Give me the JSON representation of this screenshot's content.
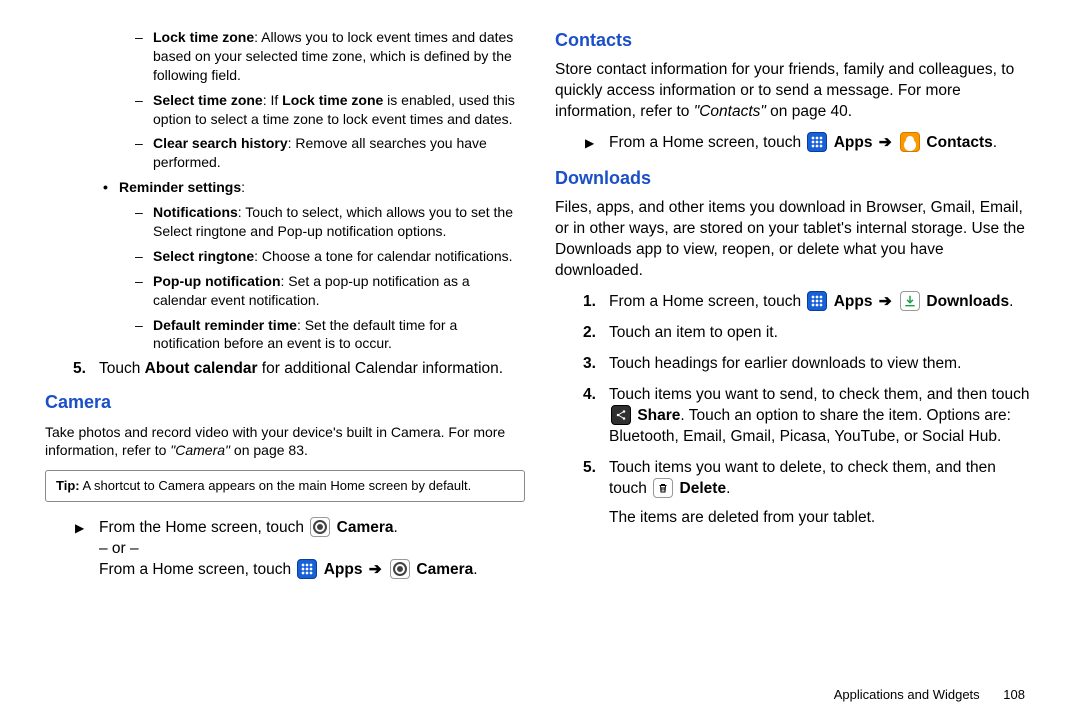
{
  "left": {
    "settings_list": [
      {
        "term": "Lock time zone",
        "desc": ": Allows you to lock event times and dates based on your selected time zone, which is defined by the following field."
      },
      {
        "term": "Select time zone",
        "desc": ": If ",
        "term2": "Lock time zone",
        "desc2": " is enabled, used this option to select a time zone to lock event times and dates."
      },
      {
        "term": "Clear search history",
        "desc": ": Remove all searches you have performed."
      }
    ],
    "reminder_heading": "Reminder settings",
    "reminder_list": [
      {
        "term": "Notifications",
        "desc": ": Touch to select, which allows you to set the Select ringtone and Pop-up notification options."
      },
      {
        "term": "Select ringtone",
        "desc": ": Choose a tone for calendar notifications."
      },
      {
        "term": "Pop-up notification",
        "desc": ": Set a pop-up notification as a calendar event notification."
      },
      {
        "term": "Default reminder time",
        "desc": ": Set the default time for a notification before an event is to occur."
      }
    ],
    "step5": {
      "num": "5.",
      "pre": "Touch ",
      "bold": "About calendar",
      "post": " for additional Calendar information."
    },
    "camera_heading": "Camera",
    "camera_para_a": "Take photos and record video with your device's built in Camera. For more information, refer to ",
    "camera_ref": "\"Camera\"",
    "camera_para_b": " on page 83.",
    "tip_label": "Tip:",
    "tip_text": " A shortcut to Camera appears on the main Home screen by default.",
    "camera_step": {
      "pre": "From the Home screen, touch ",
      "label": "Camera",
      "or": "– or –",
      "pre2": "From a Home screen, touch ",
      "apps": "Apps",
      "arrow": "➔",
      "label2": "Camera"
    }
  },
  "right": {
    "contacts_heading": "Contacts",
    "contacts_para_a": "Store contact information for your friends, family and colleagues, to quickly access information or to send a message. For more information, refer to ",
    "contacts_ref": "\"Contacts\"",
    "contacts_para_b": " on page 40.",
    "contacts_step": {
      "pre": "From a Home screen, touch ",
      "apps": "Apps",
      "arrow": "➔",
      "label": "Contacts"
    },
    "downloads_heading": "Downloads",
    "downloads_para": "Files, apps, and other items you download in Browser, Gmail, Email, or in other ways, are stored on your tablet's internal storage. Use the Downloads app to view, reopen, or delete what you have downloaded.",
    "dl_steps": {
      "s1": {
        "num": "1.",
        "pre": "From a Home screen, touch ",
        "apps": "Apps",
        "arrow": "➔",
        "label": "Downloads"
      },
      "s2": {
        "num": "2.",
        "text": "Touch an item to open it."
      },
      "s3": {
        "num": "3.",
        "text": "Touch headings for earlier downloads to view them."
      },
      "s4": {
        "num": "4.",
        "pre": "Touch items you want to send, to check them, and then touch ",
        "share": "Share",
        "post": ". Touch an option to share the item. Options are: Bluetooth, Email, Gmail, Picasa, YouTube, or Social Hub."
      },
      "s5": {
        "num": "5.",
        "pre": "Touch items you want to delete, to check them, and then touch ",
        "del": "Delete",
        "post": ".",
        "line2": "The items are deleted from your tablet."
      }
    }
  },
  "footer": {
    "section": "Applications and Widgets",
    "page": "108"
  }
}
